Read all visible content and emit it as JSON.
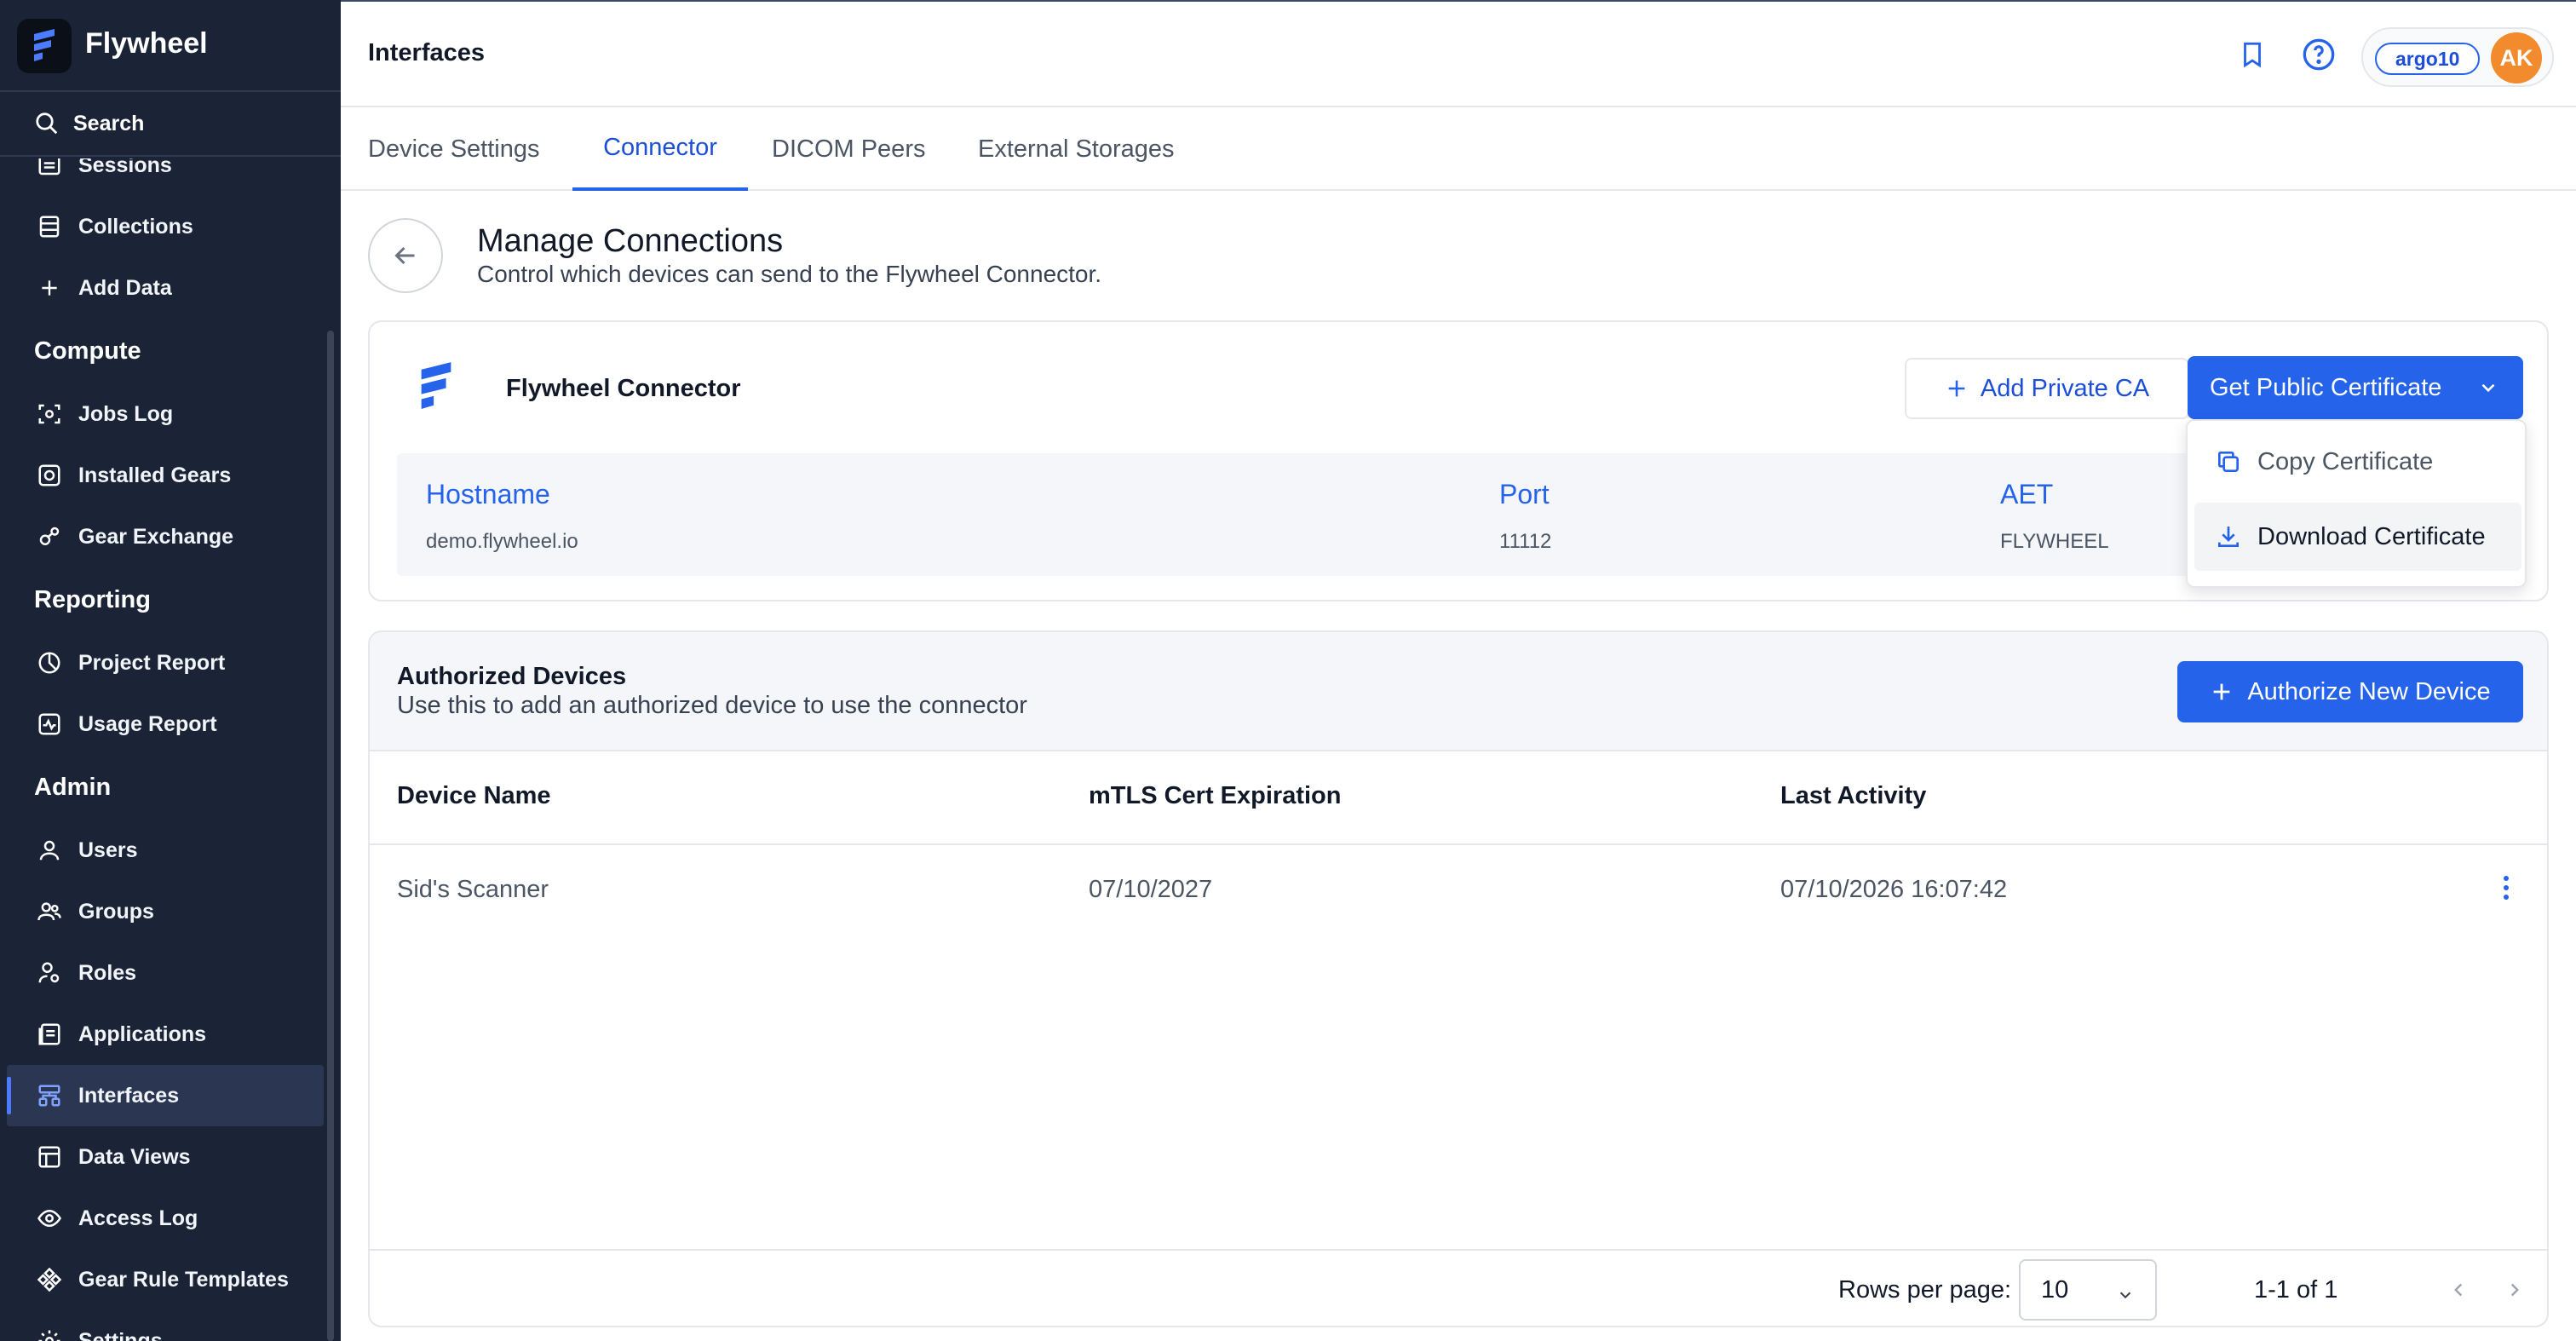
{
  "app": {
    "name": "Flywheel"
  },
  "sidebar": {
    "search_label": "Search",
    "items": [
      {
        "label": "Sessions",
        "icon": "sessions-icon"
      },
      {
        "label": "Collections",
        "icon": "collections-icon"
      },
      {
        "label": "Add Data",
        "icon": "plus-icon"
      }
    ],
    "sections": [
      {
        "title": "Compute",
        "items": [
          {
            "label": "Jobs Log",
            "icon": "jobs-log-icon"
          },
          {
            "label": "Installed Gears",
            "icon": "installed-gears-icon"
          },
          {
            "label": "Gear Exchange",
            "icon": "gear-exchange-icon"
          }
        ]
      },
      {
        "title": "Reporting",
        "items": [
          {
            "label": "Project Report",
            "icon": "project-report-icon"
          },
          {
            "label": "Usage Report",
            "icon": "usage-report-icon"
          }
        ]
      },
      {
        "title": "Admin",
        "items": [
          {
            "label": "Users",
            "icon": "user-icon"
          },
          {
            "label": "Groups",
            "icon": "groups-icon"
          },
          {
            "label": "Roles",
            "icon": "roles-icon"
          },
          {
            "label": "Applications",
            "icon": "applications-icon"
          },
          {
            "label": "Interfaces",
            "icon": "interfaces-icon",
            "active": true
          },
          {
            "label": "Data Views",
            "icon": "data-views-icon"
          },
          {
            "label": "Access Log",
            "icon": "eye-icon"
          },
          {
            "label": "Gear Rule Templates",
            "icon": "gear-rule-templates-icon"
          },
          {
            "label": "Settings",
            "icon": "settings-icon"
          }
        ]
      }
    ]
  },
  "header": {
    "title": "Interfaces",
    "user_tag": "argo10",
    "avatar_initials": "AK",
    "bookmark_icon": "bookmark-icon",
    "help_icon": "help-icon"
  },
  "tabs": [
    {
      "label": "Device Settings"
    },
    {
      "label": "Connector",
      "active": true
    },
    {
      "label": "DICOM Peers"
    },
    {
      "label": "External Storages"
    }
  ],
  "manage": {
    "title": "Manage Connections",
    "subtitle": "Control which devices can send to the Flywheel Connector."
  },
  "connector": {
    "name": "Flywheel Connector",
    "add_ca_label": "Add Private CA",
    "get_cert_label": "Get Public Certificate",
    "hostname_label": "Hostname",
    "hostname_value": "demo.flywheel.io",
    "port_label": "Port",
    "port_value": "11112",
    "aet_label": "AET",
    "aet_value": "FLYWHEEL"
  },
  "cert_menu": {
    "copy_label": "Copy Certificate",
    "download_label": "Download Certificate"
  },
  "devices": {
    "title": "Authorized Devices",
    "subtitle": "Use this to add an authorized device to use the connector",
    "authorize_label": "Authorize New Device",
    "columns": [
      "Device Name",
      "mTLS Cert Expiration",
      "Last Activity"
    ],
    "rows": [
      {
        "name": "Sid's Scanner",
        "expiration": "07/10/2027",
        "last_activity": "07/10/2026 16:07:42"
      }
    ],
    "rows_per_page_label": "Rows per page:",
    "rows_per_page_value": "10",
    "range_label": "1-1 of 1"
  },
  "colors": {
    "sidebar_bg": "#1b2436",
    "accent": "#2563eb",
    "avatar": "#f28b2d"
  }
}
